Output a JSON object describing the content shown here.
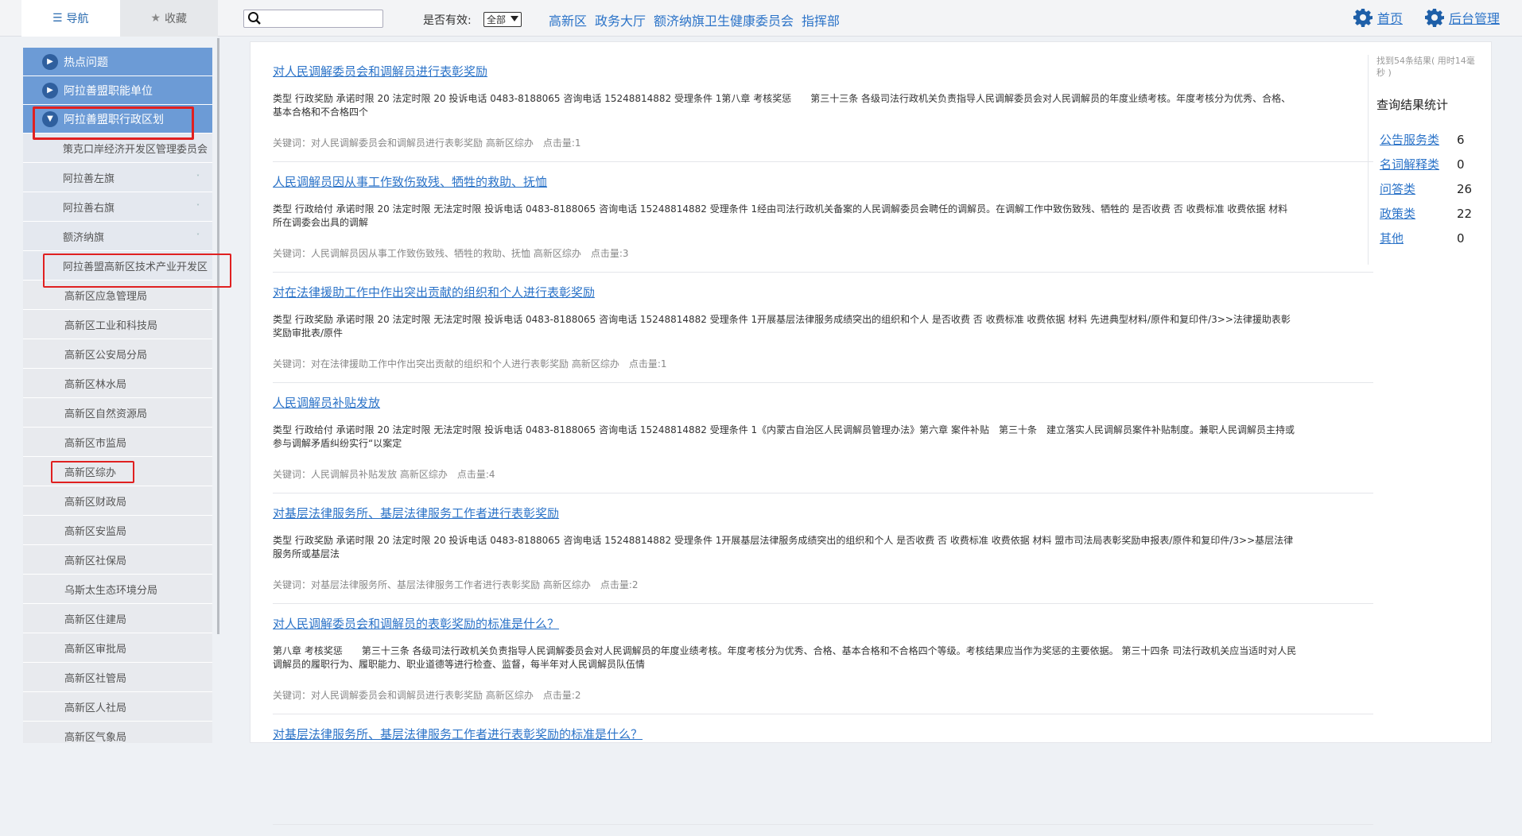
{
  "tabs": [
    {
      "label": "导航",
      "icon": "list-icon",
      "active": true
    },
    {
      "label": "收藏",
      "icon": "star-icon",
      "active": false
    }
  ],
  "search": {
    "placeholder": "",
    "value": ""
  },
  "filter": {
    "label": "是否有效:",
    "selected": "全部"
  },
  "breadcrumbs": [
    "高新区",
    "政务大厅",
    "额济纳旗卫生健康委员会",
    "指挥部"
  ],
  "header_links": [
    {
      "label": "首页",
      "icon": "gear-icon"
    },
    {
      "label": "后台管理",
      "icon": "gear-icon"
    }
  ],
  "sidebar": {
    "top_items": [
      {
        "label": "热点问题",
        "expanded": false
      },
      {
        "label": "阿拉善盟职能单位",
        "expanded": false
      },
      {
        "label": "阿拉善盟职行政区划",
        "expanded": true
      }
    ],
    "sub_items": [
      {
        "label": "策克口岸经济开发区管理委员会"
      },
      {
        "label": "阿拉善左旗"
      },
      {
        "label": "阿拉善右旗"
      },
      {
        "label": "额济纳旗"
      },
      {
        "label": "阿拉善盟高新区技术产业开发区"
      }
    ],
    "leaf_items": [
      "高新区应急管理局",
      "高新区工业和科技局",
      "高新区公安局分局",
      "高新区林水局",
      "高新区自然资源局",
      "高新区市监局",
      "高新区综办",
      "高新区财政局",
      "高新区安监局",
      "高新区社保局",
      "乌斯太生态环境分局",
      "高新区住建局",
      "高新区审批局",
      "高新区社管局",
      "高新区人社局",
      "高新区气象局"
    ]
  },
  "results": [
    {
      "title": "对人民调解委员会和调解员进行表彰奖励",
      "body": "类型 行政奖励 承诺时限 20 法定时限 20 投诉电话 0483-8188065 咨询电话 15248814882 受理条件 1第八章 考核奖惩　　第三十三条 各级司法行政机关负责指导人民调解委员会对人民调解员的年度业绩考核。年度考核分为优秀、合格、基本合格和不合格四个",
      "keywords": "关键词：对人民调解委员会和调解员进行表彰奖励 高新区综办",
      "clicks": "点击量:1"
    },
    {
      "title": "人民调解员因从事工作致伤致残、牺牲的救助、抚恤",
      "body": "类型 行政给付 承诺时限 20 法定时限 无法定时限 投诉电话 0483-8188065 咨询电话 15248814882 受理条件 1经由司法行政机关备案的人民调解委员会聘任的调解员。在调解工作中致伤致残、牺牲的 是否收费 否 收费标准 收费依据 材料 所在调委会出具的调解",
      "keywords": "关键词：人民调解员因从事工作致伤致残、牺牲的救助、抚恤 高新区综办",
      "clicks": "点击量:3"
    },
    {
      "title": "对在法律援助工作中作出突出贡献的组织和个人进行表彰奖励",
      "body": "类型 行政奖励 承诺时限 20 法定时限 无法定时限 投诉电话 0483-8188065 咨询电话 15248814882 受理条件 1开展基层法律服务成绩突出的组织和个人 是否收费 否 收费标准 收费依据 材料 先进典型材料/原件和复印件/3>>法律援助表彰奖励审批表/原件",
      "keywords": "关键词：对在法律援助工作中作出突出贡献的组织和个人进行表彰奖励 高新区综办",
      "clicks": "点击量:1"
    },
    {
      "title": "人民调解员补贴发放",
      "body": "类型 行政给付 承诺时限 20 法定时限 无法定时限 投诉电话 0483-8188065 咨询电话 15248814882 受理条件 1《内蒙古自治区人民调解员管理办法》第六章 案件补贴　第三十条　建立落实人民调解员案件补贴制度。兼职人民调解员主持或参与调解矛盾纠纷实行“以案定",
      "keywords": "关键词：人民调解员补贴发放 高新区综办",
      "clicks": "点击量:4"
    },
    {
      "title": "对基层法律服务所、基层法律服务工作者进行表彰奖励",
      "body": "类型 行政奖励 承诺时限 20 法定时限 20 投诉电话 0483-8188065 咨询电话 15248814882 受理条件 1开展基层法律服务成绩突出的组织和个人 是否收费 否 收费标准 收费依据 材料 盟市司法局表彰奖励申报表/原件和复印件/3>>基层法律服务所或基层法",
      "keywords": "关键词：对基层法律服务所、基层法律服务工作者进行表彰奖励 高新区综办",
      "clicks": "点击量:2"
    },
    {
      "title": "对人民调解委员会和调解员的表彰奖励的标准是什么？",
      "body": "第八章 考核奖惩　　第三十三条 各级司法行政机关负责指导人民调解委员会对人民调解员的年度业绩考核。年度考核分为优秀、合格、基本合格和不合格四个等级。考核结果应当作为奖惩的主要依据。 第三十四条 司法行政机关应当适时对人民调解员的履职行为、履职能力、职业道德等进行检查、监督，每半年对人民调解员队伍情",
      "keywords": "关键词：对人民调解委员会和调解员进行表彰奖励 高新区综办",
      "clicks": "点击量:2"
    },
    {
      "title": "对基层法律服务所、基层法律服务工作者进行表彰奖励的标准是什么？",
      "body": "",
      "keywords": "",
      "clicks": ""
    }
  ],
  "stats": {
    "found": "找到54条结果( 用时14毫秒 )",
    "title": "查询结果统计",
    "rows": [
      {
        "label": "公告服务类",
        "count": "6"
      },
      {
        "label": "名词解释类",
        "count": "0"
      },
      {
        "label": "问答类",
        "count": "26"
      },
      {
        "label": "政策类",
        "count": "22"
      },
      {
        "label": "其他",
        "count": "0"
      }
    ]
  }
}
